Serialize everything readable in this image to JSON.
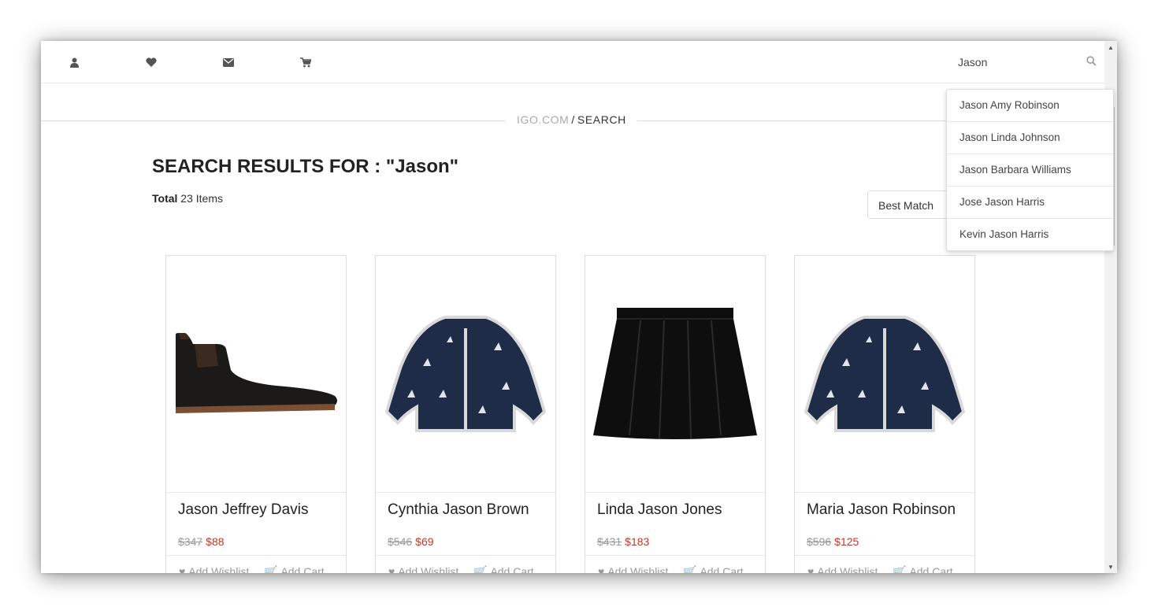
{
  "header": {
    "icons": [
      "user-icon",
      "heart-icon",
      "envelope-icon",
      "cart-icon"
    ],
    "search_value": "Jason"
  },
  "suggestions": [
    "Jason Amy Robinson",
    "Jason Linda Johnson",
    "Jason Barbara Williams",
    "Jose Jason Harris",
    "Kevin Jason Harris"
  ],
  "breadcrumb": {
    "site": "IGO.COM",
    "separator": "/",
    "current": "SEARCH"
  },
  "results": {
    "title": "SEARCH RESULTS FOR : \"Jason\"",
    "total_label": "Total",
    "total_count": "23 Items",
    "sort_value": "Best Match"
  },
  "products": [
    {
      "name": "Jason Jeffrey Davis",
      "old_price": "$347",
      "price": "$88",
      "image": "chelsea-boot"
    },
    {
      "name": "Cynthia Jason Brown",
      "old_price": "$546",
      "price": "$69",
      "image": "navy-jacket"
    },
    {
      "name": "Linda Jason Jones",
      "old_price": "$431",
      "price": "$183",
      "image": "black-skirt"
    },
    {
      "name": "Maria Jason Robinson",
      "old_price": "$596",
      "price": "$125",
      "image": "navy-jacket"
    }
  ],
  "card_actions": {
    "wishlist": "Add Wishlist",
    "cart": "Add Cart"
  },
  "colors": {
    "accent_price": "#c0392b",
    "muted": "#999999"
  }
}
